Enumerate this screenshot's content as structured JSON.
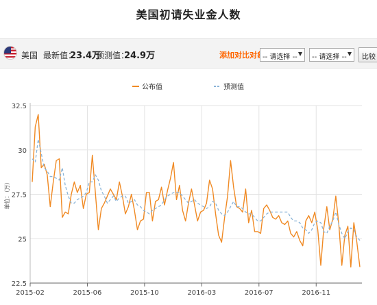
{
  "page": {
    "title": "美国初请失业金人数"
  },
  "toolbar": {
    "country": "美国",
    "latest_label": "最新值：",
    "latest_value": "23.4万",
    "forecast_label": "预测值：",
    "forecast_value": "24.9万",
    "add_compare_label": "添加对比对象：",
    "select_1_value": "-- 请选择 --",
    "select_2_value": "-- 请选择 --",
    "compare_button": "比较"
  },
  "chart_data": {
    "type": "line",
    "title": "",
    "xlabel": "",
    "ylabel": "单位：（万）",
    "ylim": [
      22.5,
      32.5
    ],
    "yticks": [
      22.5,
      25,
      27.5,
      30,
      32.5
    ],
    "ytick_labels": [
      "22.5",
      "25",
      "27.5",
      "30",
      "32.5"
    ],
    "xtick_labels": [
      "2015-02",
      "2015-06",
      "2015-10",
      "2016-03",
      "2016-07",
      "2016-11"
    ],
    "grid": true,
    "legend_position": "top-center",
    "colors": {
      "actual": "#f08a24",
      "forecast": "#8ab4d8"
    },
    "series": [
      {
        "name": "公布值",
        "style": "solid",
        "values": [
          28.2,
          31.3,
          32.0,
          29.0,
          29.2,
          28.6,
          26.8,
          28.2,
          29.4,
          29.5,
          26.2,
          26.5,
          26.4,
          27.5,
          28.2,
          27.6,
          28.0,
          26.7,
          27.5,
          27.6,
          29.7,
          27.6,
          25.5,
          26.7,
          27.0,
          27.4,
          27.8,
          27.5,
          27.2,
          28.2,
          27.4,
          26.4,
          26.8,
          27.5,
          26.6,
          25.5,
          26.0,
          26.1,
          27.6,
          27.6,
          26.0,
          27.1,
          27.2,
          27.9,
          26.9,
          27.7,
          28.4,
          29.3,
          27.2,
          28.0,
          26.6,
          26.0,
          27.0,
          27.8,
          26.9,
          26.0,
          26.5,
          26.6,
          27.0,
          28.3,
          27.8,
          26.4,
          25.2,
          24.8,
          26.2,
          27.4,
          29.4,
          27.9,
          26.8,
          26.7,
          26.5,
          27.8,
          25.9,
          26.6,
          25.4,
          25.4,
          25.3,
          26.7,
          26.9,
          26.6,
          26.2,
          26.1,
          26.3,
          25.9,
          25.8,
          26.0,
          25.3,
          25.1,
          25.4,
          24.9,
          24.6,
          26.0,
          26.3,
          25.9,
          26.5,
          25.5,
          23.5,
          25.6,
          26.8,
          25.5,
          26.1,
          27.4,
          25.8,
          23.5,
          25.2,
          25.7,
          23.4,
          25.9,
          24.8,
          23.4
        ]
      },
      {
        "name": "预测值",
        "style": "dashed",
        "values": [
          29.5,
          29.3,
          30.6,
          29.8,
          29.0,
          28.8,
          28.5,
          28.5,
          28.4,
          28.3,
          29.0,
          28.0,
          27.4,
          27.0,
          27.0,
          27.2,
          27.3,
          27.4,
          27.6,
          28.2,
          28.2,
          28.6,
          28.3,
          27.7,
          27.4,
          27.0,
          27.2,
          27.4,
          27.1,
          27.3,
          27.4,
          27.4,
          27.0,
          27.1,
          27.2,
          26.9,
          26.8,
          26.6,
          26.5,
          26.4,
          26.6,
          26.7,
          26.8,
          26.9,
          27.2,
          27.4,
          27.5,
          27.6,
          27.6,
          27.6,
          27.4,
          27.2,
          27.0,
          27.1,
          27.2,
          27.0,
          26.9,
          26.8,
          26.7,
          26.8,
          27.1,
          27.0,
          26.6,
          26.4,
          26.3,
          26.5,
          26.8,
          27.1,
          26.8,
          26.8,
          26.7,
          26.5,
          26.4,
          26.4,
          26.2,
          26.0,
          26.0,
          26.2,
          26.4,
          26.5,
          26.5,
          26.5,
          26.5,
          26.5,
          26.5,
          26.5,
          26.2,
          26.0,
          26.0,
          25.9,
          25.6,
          25.5,
          25.3,
          25.5,
          25.9,
          26.0,
          25.9,
          25.4,
          25.3,
          25.7,
          26.0,
          26.5,
          25.8,
          25.3,
          25.0,
          25.4,
          25.6,
          25.5,
          25.1,
          24.9
        ]
      }
    ]
  }
}
